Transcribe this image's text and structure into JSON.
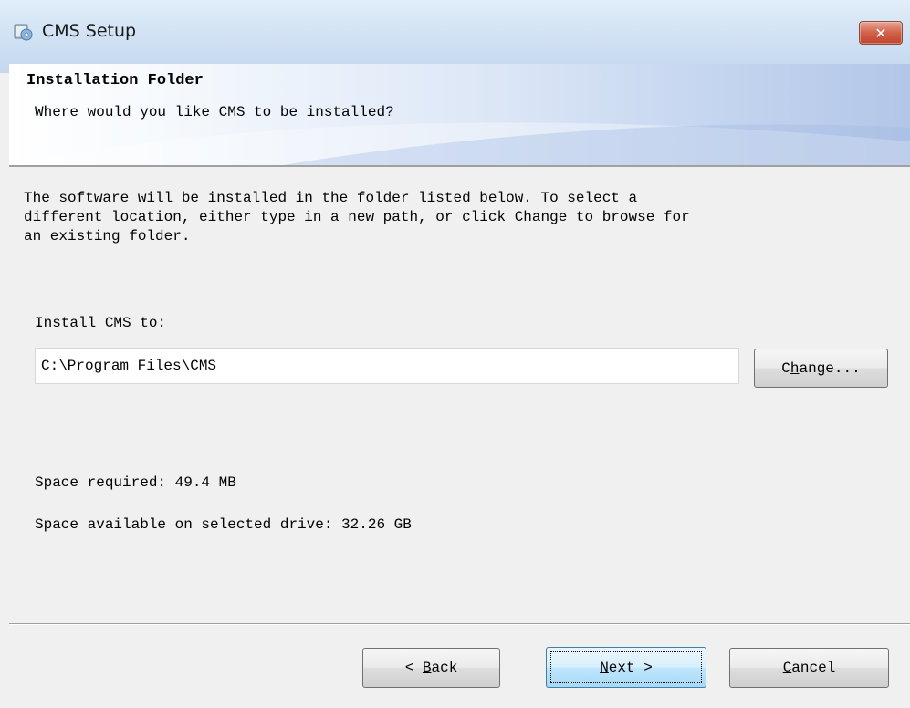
{
  "window": {
    "title": "CMS Setup",
    "close_label": "✕",
    "app_icon": "setup-installer-icon"
  },
  "header": {
    "title": "Installation Folder",
    "subtitle": "Where would you like CMS to be installed?"
  },
  "main": {
    "description": "The software will be installed in the folder listed below. To select a\ndifferent location, either type in a new path, or click Change to browse for\nan existing folder.",
    "install_label": "Install CMS to:",
    "install_path": "C:\\Program Files\\CMS",
    "change_button": {
      "mnemonic": "h",
      "prefix": "C",
      "suffix": "ange..."
    },
    "space_required": "Space required: 49.4 MB",
    "space_available": "Space available on selected drive: 32.26 GB"
  },
  "buttons": {
    "back": {
      "prefix": "< ",
      "mnemonic": "B",
      "suffix": "ack"
    },
    "next": {
      "prefix": "",
      "mnemonic": "N",
      "suffix": "ext >"
    },
    "cancel": {
      "prefix": "",
      "mnemonic": "C",
      "suffix": "ancel"
    }
  },
  "colors": {
    "titlebar": "#c4d7ee",
    "close_button": "#c0422c",
    "default_button_border": "#3c7fb1"
  }
}
